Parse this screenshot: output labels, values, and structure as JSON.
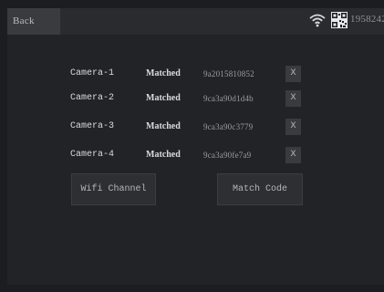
{
  "header": {
    "back_label": "Back",
    "device_id": "195824277",
    "icons": [
      "wifi-icon",
      "qr-code-icon"
    ]
  },
  "cameras": [
    {
      "name": "Camera-1",
      "status": "Matched",
      "code": "9a2015810852",
      "remove_label": "X"
    },
    {
      "name": "Camera-2",
      "status": "Matched",
      "code": "9ca3a90d1d4b",
      "remove_label": "X"
    },
    {
      "name": "Camera-3",
      "status": "Matched",
      "code": "9ca3a90c3779",
      "remove_label": "X"
    },
    {
      "name": "Camera-4",
      "status": "Matched",
      "code": "9ca3a90fe7a9",
      "remove_label": "X"
    }
  ],
  "actions": {
    "wifi_channel_label": "Wifi Channel",
    "match_code_label": "Match Code"
  }
}
